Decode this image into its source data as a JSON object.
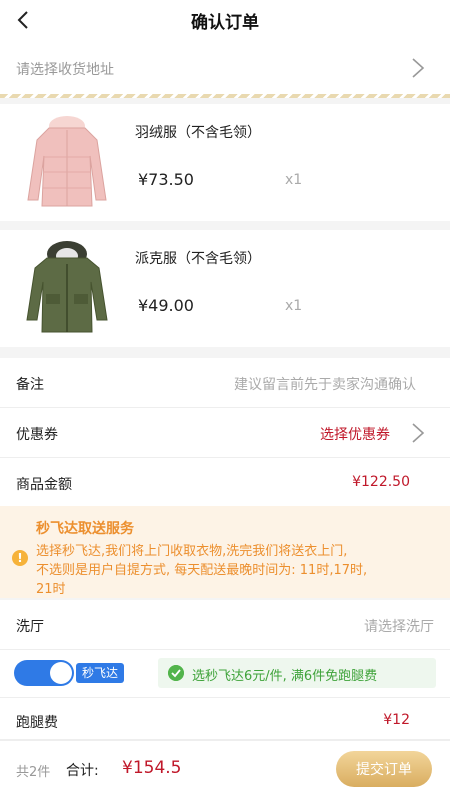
{
  "header": {
    "title": "确认订单",
    "back_icon": "back-arrow-icon"
  },
  "address": {
    "placeholder": "请选择收货地址",
    "icon": "chevron-right-icon"
  },
  "products": [
    {
      "name": "羽绒服（不含毛领）",
      "price": "¥73.50",
      "qty": "x1",
      "image": "pink-down-jacket-image",
      "image_color": "#f0c0bd"
    },
    {
      "name": "派克服（不含毛领）",
      "price": "¥49.00",
      "qty": "x1",
      "image": "green-parka-image",
      "image_color": "#5d6b45"
    }
  ],
  "remark": {
    "label": "备注",
    "placeholder": "建议留言前先于卖家沟通确认"
  },
  "coupon": {
    "label": "优惠券",
    "value": "选择优惠券"
  },
  "goods_amount": {
    "label": "商品金额",
    "value": "¥122.50"
  },
  "notice": {
    "title": "秒飞达取送服务",
    "lines": [
      "选择秒飞达,我们将上门收取衣物,洗完我们将送衣上门,",
      "不选则是用户自提方式, 每天配送最晚时间为: 11时,17时,",
      "21时"
    ],
    "icon": "warning-icon"
  },
  "laundry": {
    "label": "洗厅",
    "placeholder": "请选择洗厅"
  },
  "delivery": {
    "toggle_on": true,
    "tag": "秒飞达",
    "promo_text": "选秒飞达6元/件, 满6件免跑腿费",
    "promo_icon": "check-circle-icon"
  },
  "errand_fee": {
    "label": "跑腿费",
    "value": "¥12"
  },
  "footer": {
    "count": "共2件",
    "total_label": "合计:",
    "total_value": "¥154.5",
    "submit_label": "提交订单"
  },
  "colors": {
    "accent_red": "#c0182a",
    "toggle_blue": "#2f7ae6",
    "notice_orange": "#ec8f2e",
    "promo_green": "#3fa33a",
    "submit_gold": "#d9ad60"
  }
}
